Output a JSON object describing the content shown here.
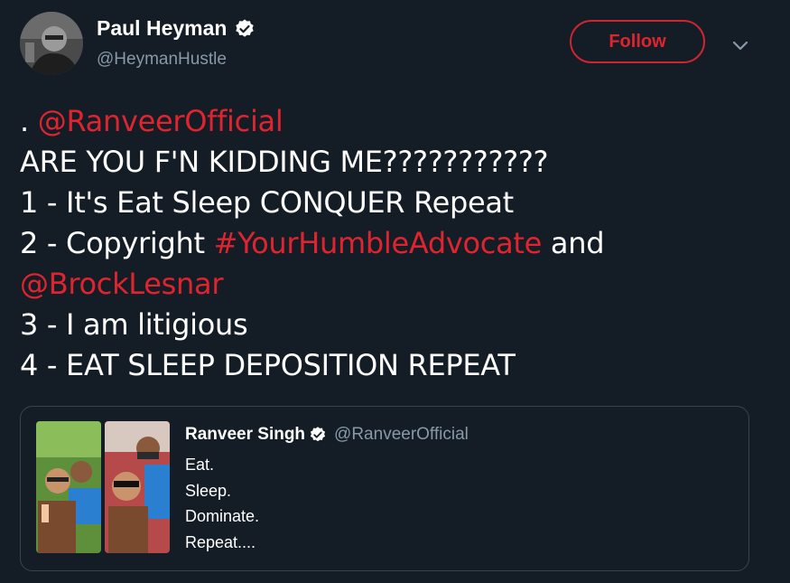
{
  "author": {
    "name": "Paul Heyman",
    "handle": "@HeymanHustle"
  },
  "follow_label": "Follow",
  "tweet": {
    "line1_prefix": ". ",
    "line1_mention": "@RanveerOfficial",
    "line2": "ARE YOU F'N KIDDING ME???????????",
    "line3": "1 - It's Eat Sleep CONQUER Repeat",
    "line4_prefix": "2 - Copyright ",
    "line4_hashtag": "#YourHumbleAdvocate",
    "line4_suffix": " and",
    "line5_mention": "@BrockLesnar",
    "line6": "3 - I am litigious",
    "line7": "4 - EAT SLEEP DEPOSITION REPEAT"
  },
  "quoted": {
    "name": "Ranveer Singh",
    "handle": "@RanveerOfficial",
    "lines": [
      "Eat.",
      "Sleep.",
      "Dominate.",
      "Repeat...."
    ]
  },
  "colors": {
    "background": "#141d26",
    "accent": "#e0242f",
    "muted": "#8899a6",
    "border": "#38444d"
  },
  "icons": {
    "verified": "verified-badge-icon",
    "caret": "chevron-down-icon"
  }
}
